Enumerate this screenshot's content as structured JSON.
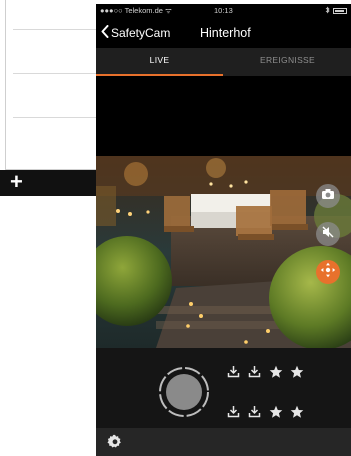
{
  "status_bar": {
    "carrier": "●●●○○ Telekom.de ᯤ",
    "time": "10:13"
  },
  "nav": {
    "back_label": "SafetyCam",
    "title": "Hinterhof"
  },
  "tabs": [
    {
      "label": "LIVE",
      "active": true
    },
    {
      "label": "EREIGNISSE",
      "active": false
    }
  ],
  "colors": {
    "accent": "#e8712c",
    "tab_bar": "#1f1f1f",
    "controls_bg": "#151515",
    "bottom_bar": "#262626"
  },
  "icons": {
    "side_buttons": [
      "camera-icon",
      "speaker-mute-icon",
      "ptz-crosshair-icon"
    ],
    "clip_row": [
      "download-icon",
      "download-icon",
      "star-icon",
      "star-icon"
    ],
    "bottom": "gear-icon",
    "left_toolbar": "plus-icon"
  },
  "left_app": {
    "toolbar_plus": "+"
  }
}
